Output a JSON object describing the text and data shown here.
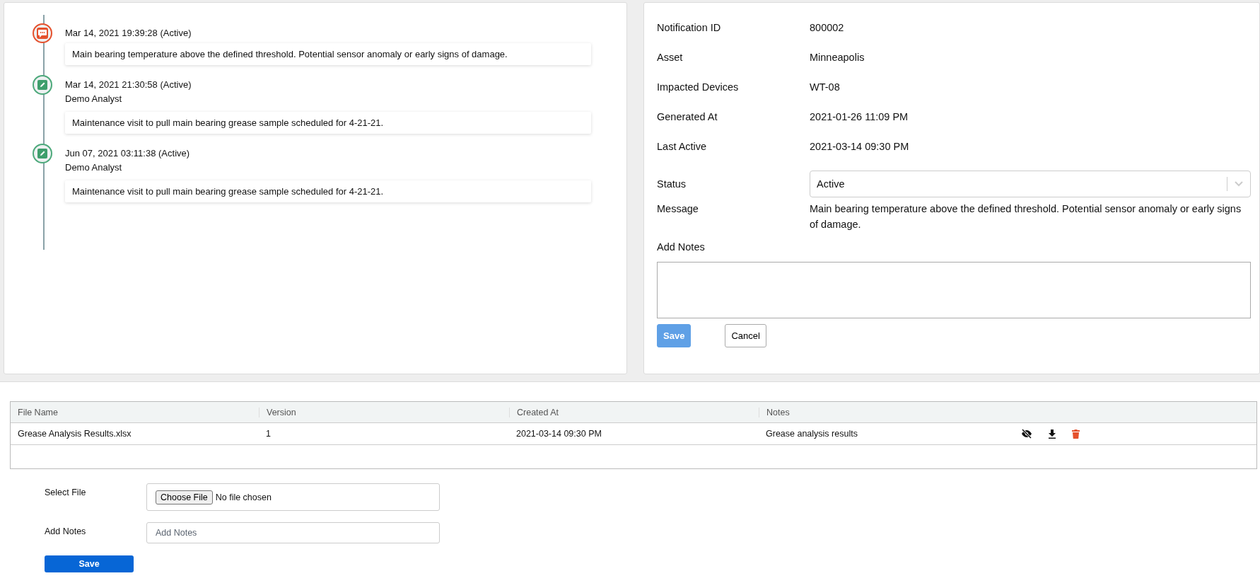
{
  "timeline": {
    "entries": [
      {
        "kind": "alert",
        "time": "Mar 14, 2021 19:39:28 (Active)",
        "note": "Main bearing temperature above the defined threshold. Potential sensor anomaly or early signs of damage."
      },
      {
        "kind": "note",
        "time": "Mar 14, 2021 21:30:58 (Active)",
        "author": "Demo Analyst",
        "note": "Maintenance visit to pull main bearing grease sample scheduled for 4-21-21."
      },
      {
        "kind": "note",
        "time": "Jun 07, 2021 03:11:38 (Active)",
        "author": "Demo Analyst",
        "note": "Maintenance visit to pull main bearing grease sample scheduled for 4-21-21."
      }
    ]
  },
  "details": {
    "fields": [
      {
        "kind": "text",
        "label": "Notification ID",
        "value": "800002"
      },
      {
        "kind": "text",
        "label": "Asset",
        "value": "Minneapolis"
      },
      {
        "kind": "text",
        "label": "Impacted Devices",
        "value": "WT-08"
      },
      {
        "kind": "text",
        "label": "Generated At",
        "value": "2021-01-26 11:09 PM"
      },
      {
        "kind": "text",
        "label": "Last Active",
        "value": "2021-03-14 09:30 PM"
      },
      {
        "kind": "select",
        "label": "Status",
        "value": "Active"
      },
      {
        "kind": "text",
        "label": "Message",
        "value": "Main bearing temperature above the defined threshold. Potential sensor anomaly or early signs of damage."
      }
    ],
    "notes_label": "Add Notes",
    "save_button": {
      "label": "Save",
      "disabled": true
    },
    "cancel_button": {
      "label": "Cancel",
      "disabled": false
    }
  },
  "files": {
    "columns": [
      "File Name",
      "Version",
      "Created At",
      "Notes"
    ],
    "rows": [
      {
        "file_name": "Grease Analysis Results.xlsx",
        "version": "1",
        "created_at": "2021-03-14 09:30 PM",
        "notes": "Grease analysis results"
      }
    ],
    "select_file_label": "Select File",
    "choose_button": "Choose File",
    "no_file_text": "No file chosen",
    "notes_label": "Add Notes",
    "notes_placeholder": "Add Notes",
    "save_button": "Save"
  }
}
